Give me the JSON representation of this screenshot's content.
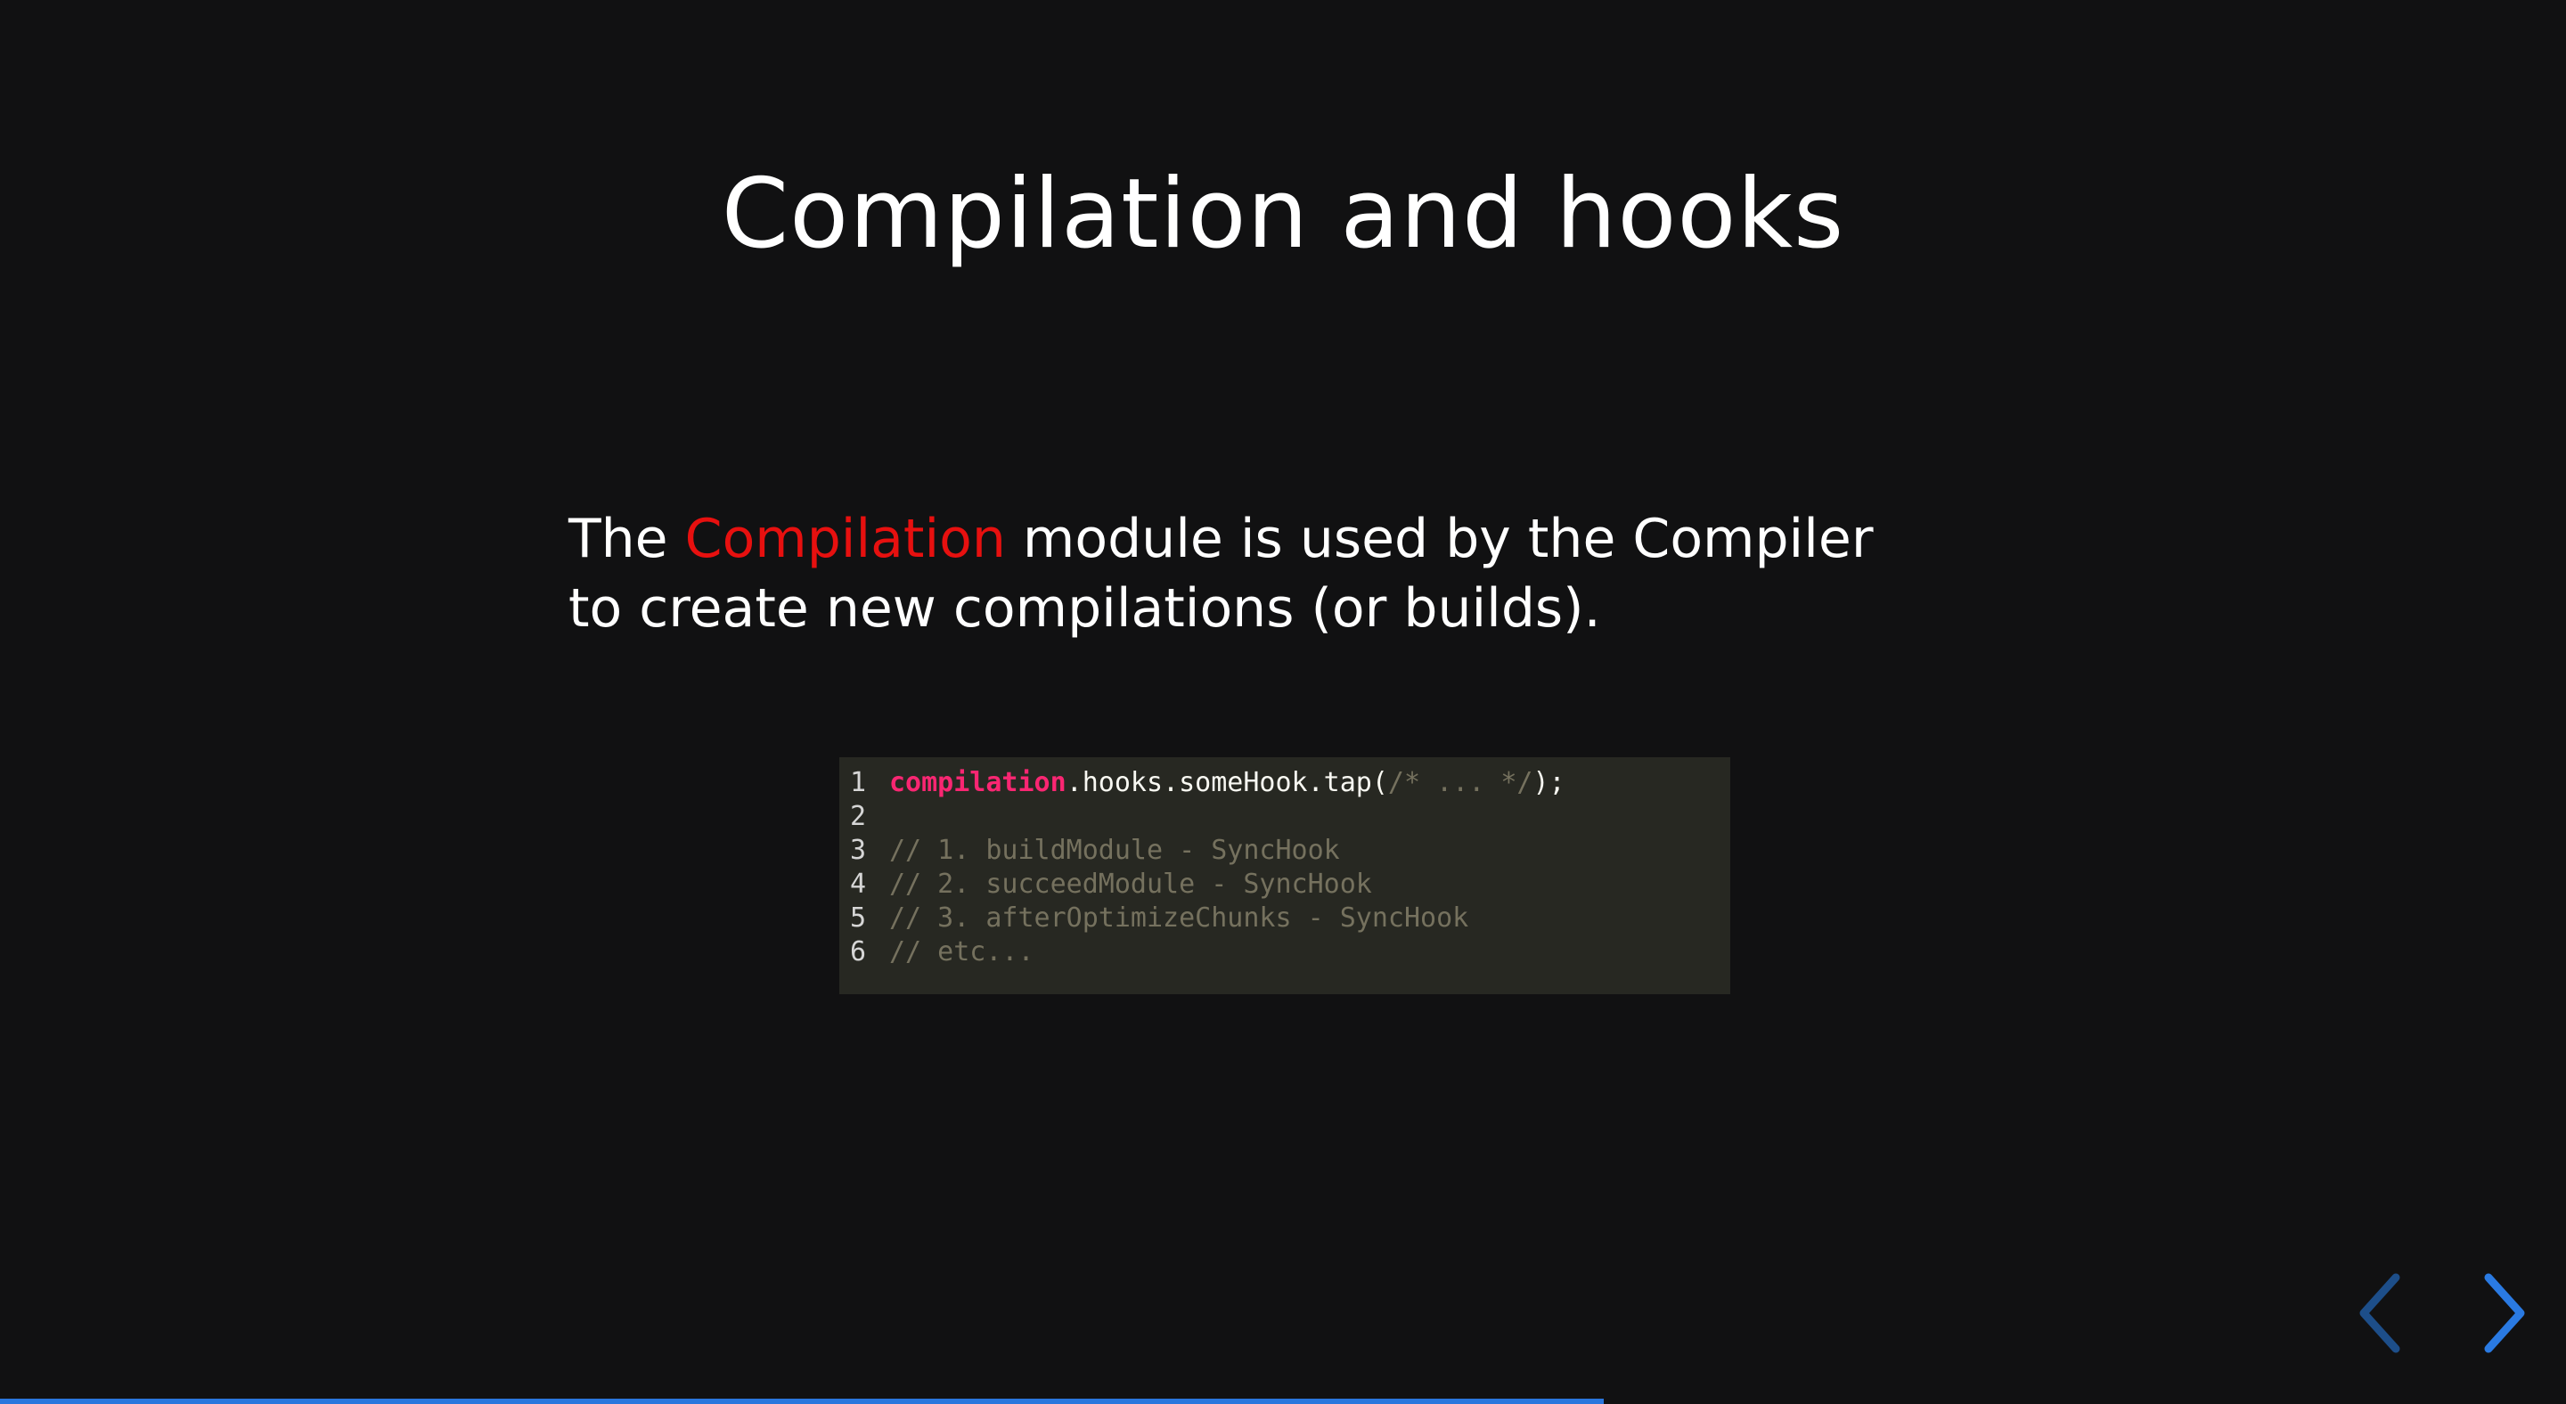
{
  "slide": {
    "title": "Compilation and hooks",
    "intro": {
      "before": "The ",
      "highlight": "Compilation",
      "after": " module is used by the Compiler to create new compilations (or builds)."
    }
  },
  "code": {
    "lines": [
      {
        "n": "1",
        "parts": [
          [
            "kw",
            "compilation"
          ],
          [
            "plain",
            ".hooks.someHook.tap("
          ],
          [
            "cmt",
            "/* ... */"
          ],
          [
            "plain",
            ");"
          ]
        ]
      },
      {
        "n": "2",
        "parts": []
      },
      {
        "n": "3",
        "parts": [
          [
            "cmt",
            "// 1. buildModule - SyncHook"
          ]
        ]
      },
      {
        "n": "4",
        "parts": [
          [
            "cmt",
            "// 2. succeedModule - SyncHook"
          ]
        ]
      },
      {
        "n": "5",
        "parts": [
          [
            "cmt",
            "// 3. afterOptimizeChunks - SyncHook"
          ]
        ]
      },
      {
        "n": "6",
        "parts": [
          [
            "cmt",
            "// etc..."
          ]
        ]
      }
    ]
  },
  "navigation": {
    "prev_icon": "chevron-left-icon",
    "next_icon": "chevron-right-icon",
    "prev_color": "#1d4e89",
    "next_color": "#2a7ae2"
  },
  "progress": {
    "fraction": 0.625,
    "color": "#2a76dd"
  }
}
